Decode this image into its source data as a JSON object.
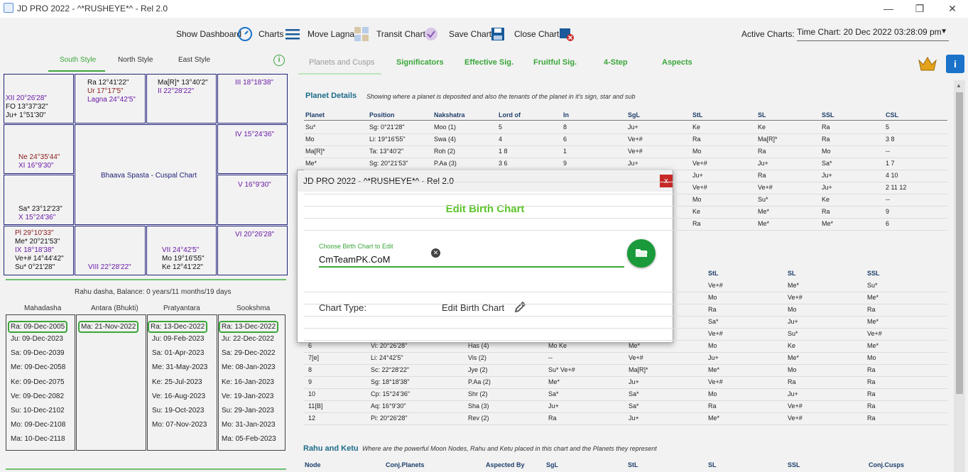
{
  "window": {
    "title": "JD PRO 2022 - ^*RUSHEYE*^  - Rel 2.0",
    "minimize": "—",
    "restore": "❐",
    "close": "✕"
  },
  "toolbar": {
    "show_dashboard": "Show Dashboard",
    "charts": "Charts",
    "move_lagna": "Move Lagna",
    "transit_chart": "Transit Chart",
    "save_chart": "Save Chart",
    "close_chart": "Close Chart",
    "active_charts_label": "Active Charts:",
    "active_charts_value": "Time Chart: 20 Dec 2022 03:28:09 pm"
  },
  "style_tabs": {
    "south": "South Style",
    "north": "North Style",
    "east": "East Style"
  },
  "south_chart": {
    "center_label": "Bhaava Spasta - Cuspal Chart",
    "c1": [
      "XII 20°26'28\"",
      "FO  13°37'32\"",
      "Ju+ 1°51'30\""
    ],
    "c2": [
      "Ra 12°41'22\"",
      "Ur 17°17'5\"",
      "Lagna 24°42'5\""
    ],
    "c3": [
      "Ma[R]* 13°40'2\"",
      "II 22°28'22\""
    ],
    "c4": [
      "III 18°18'38\""
    ],
    "c5": [
      "Ne 24°35'44\"",
      "XI 16°9'30\""
    ],
    "c8": [
      "IV 15°24'36\""
    ],
    "c9": [
      "Sa* 23°12'23\"",
      "X 15°24'36\""
    ],
    "c12": [
      "V 16°9'30\""
    ],
    "c13": [
      "Pl 29°10'33\"",
      "Me* 20°21'53\"",
      "IX 18°18'38\"",
      "Ve+# 14°44'42\"",
      "Su* 0°21'28\""
    ],
    "c14": [
      "VIII 22°28'22\""
    ],
    "c15": [
      "VII 24°42'5\"",
      "Mo 19°16'55\"",
      "Ke 12°41'22\""
    ],
    "c16": [
      "VI 20°26'28\""
    ]
  },
  "dasha": {
    "balance": "Rahu dasha, Balance: 0 years/11 months/19 days",
    "headers": [
      "Mahadasha",
      "Antara (Bhukti)",
      "Pratyantara",
      "Sookshma"
    ],
    "maha": [
      "Ra: 09-Dec-2005",
      "Ju: 09-Dec-2023",
      "Sa: 09-Dec-2039",
      "Me: 09-Dec-2058",
      "Ke: 09-Dec-2075",
      "Ve: 09-Dec-2082",
      "Su: 10-Dec-2102",
      "Mo: 09-Dec-2108",
      "Ma: 10-Dec-2118"
    ],
    "antara": [
      "Ma: 21-Nov-2022"
    ],
    "pratyantara": [
      "Ra: 13-Dec-2022",
      "Ju: 09-Feb-2023",
      "Sa: 01-Apr-2023",
      "Me: 31-May-2023",
      "Ke: 25-Jul-2023",
      "Ve: 16-Aug-2023",
      "Su: 19-Oct-2023",
      "Mo: 07-Nov-2023"
    ],
    "sookshma": [
      "Ra: 13-Dec-2022",
      "Ju: 22-Dec-2022",
      "Sa: 29-Dec-2022",
      "Me: 08-Jan-2023",
      "Ke: 16-Jan-2023",
      "Ve: 19-Jan-2023",
      "Su: 29-Jan-2023",
      "Mo: 31-Jan-2023",
      "Ma: 05-Feb-2023"
    ]
  },
  "right_tabs": [
    "Planets and Cusps",
    "Significators",
    "Effective Sig.",
    "Fruitful Sig.",
    "4-Step",
    "Aspects"
  ],
  "planet_details": {
    "title": "Planet Details",
    "desc": "Showing where a planet is deposited and also the tenants of the planet in it's sign, star and sub",
    "headers": [
      "Planet",
      "Position",
      "Nakshatra",
      "Lord of",
      "In",
      "SgL",
      "StL",
      "SL",
      "SSL",
      "CSL"
    ],
    "rows": [
      [
        "Su*",
        "Sg: 0°21'28\"",
        "Moo (1)",
        "5",
        "8",
        "Ju+",
        "Ke",
        "Ke",
        "Ra",
        "5"
      ],
      [
        "Mo",
        "Li: 19°16'55\"",
        "Swa (4)",
        "4",
        "6",
        "Ve+#",
        "Ra",
        "Ma[R]*",
        "Ra",
        "3   8"
      ],
      [
        "Ma[R]*",
        "Ta: 13°40'2\"",
        "Roh (2)",
        "1   8",
        "1",
        "Ve+#",
        "Mo",
        "Ra",
        "Mo",
        "--"
      ],
      [
        "Me*",
        "Sg: 20°21'53\"",
        "P.Aa (3)",
        "3   6",
        "9",
        "Ju+",
        "Ve+#",
        "Ju+",
        "Sa*",
        "1   7"
      ],
      [
        "",
        "",
        "",
        "",
        "",
        "",
        "Ju+",
        "Ra",
        "Ju+",
        "4   10"
      ],
      [
        "",
        "",
        "",
        "",
        "",
        "",
        "Ve+#",
        "Ve+#",
        "Ju+",
        "2   11   12"
      ],
      [
        "",
        "",
        "",
        "",
        "",
        "",
        "Mo",
        "Su*",
        "Ke",
        "--"
      ],
      [
        "",
        "",
        "",
        "",
        "",
        "",
        "Ke",
        "Me*",
        "Ra",
        "9"
      ],
      [
        "",
        "",
        "",
        "",
        "",
        "",
        "Ra",
        "Me*",
        "Me*",
        "6"
      ]
    ]
  },
  "cusp_details": {
    "headers": [
      "StL",
      "SL",
      "SSL"
    ],
    "rows_top": [
      [
        "Ve+#",
        "Me*",
        "Su*"
      ],
      [
        "Mo",
        "Ve+#",
        "Me*"
      ],
      [
        "Ra",
        "Mo",
        "Ra"
      ],
      [
        "Sa*",
        "Ju+",
        "Me*"
      ],
      [
        "Ve+#",
        "Su*",
        "Ve+#"
      ]
    ],
    "rows": [
      [
        "6",
        "Vi: 20°26'28\"",
        "Has (4)",
        "Mo  Ke",
        "Me*",
        "Mo",
        "Ke",
        "Me*"
      ],
      [
        "7[e]",
        "Li: 24°42'5\"",
        "Vis (2)",
        "--",
        "Ve+#",
        "Ju+",
        "Me*",
        "Mo"
      ],
      [
        "8",
        "Sc: 22°28'22\"",
        "Jye (2)",
        "Su*  Ve+#",
        "Ma[R]*",
        "Me*",
        "Mo",
        "Ra"
      ],
      [
        "9",
        "Sg: 18°18'38\"",
        "P.Aa (2)",
        "Me*",
        "Ju+",
        "Ve+#",
        "Ra",
        "Ra"
      ],
      [
        "10",
        "Cp: 15°24'36\"",
        "Shr (2)",
        "Sa*",
        "Sa*",
        "Mo",
        "Ju+",
        "Ra"
      ],
      [
        "11[B]",
        "Aq: 16°9'30\"",
        "Sha (3)",
        "Ju+",
        "Sa*",
        "Ra",
        "Ve+#",
        "Ra"
      ],
      [
        "12",
        "Pi: 20°26'28\"",
        "Rev (2)",
        "Ra",
        "Ju+",
        "Me*",
        "Ve+#",
        "Ra"
      ]
    ]
  },
  "rahu_ketu": {
    "title": "Rahu and Ketu",
    "desc": "Where are the powerful Moon Nodes, Rahu and Ketu placed in this chart and the Planets they represent",
    "headers": [
      "Node",
      "Conj.Planets",
      "Aspected By",
      "SgL",
      "StL",
      "SL",
      "SSL",
      "Conj.Cusps"
    ]
  },
  "modal": {
    "title": "JD PRO 2022 - ^*RUSHEYE*^  - Rel 2.0",
    "close": "x",
    "heading": "Edit Birth Chart",
    "choose_label": "Choose Birth Chart to Edit",
    "input_value": "CmTeamPK.CoM",
    "clear": "✕",
    "chart_type_label": "Chart Type:",
    "chart_type_value": "Edit Birth Chart"
  },
  "colors": {
    "accent": "#3aa63a",
    "chart_border": "#22227a",
    "info_blue": "#1a73c9",
    "close_red": "#c62828"
  }
}
